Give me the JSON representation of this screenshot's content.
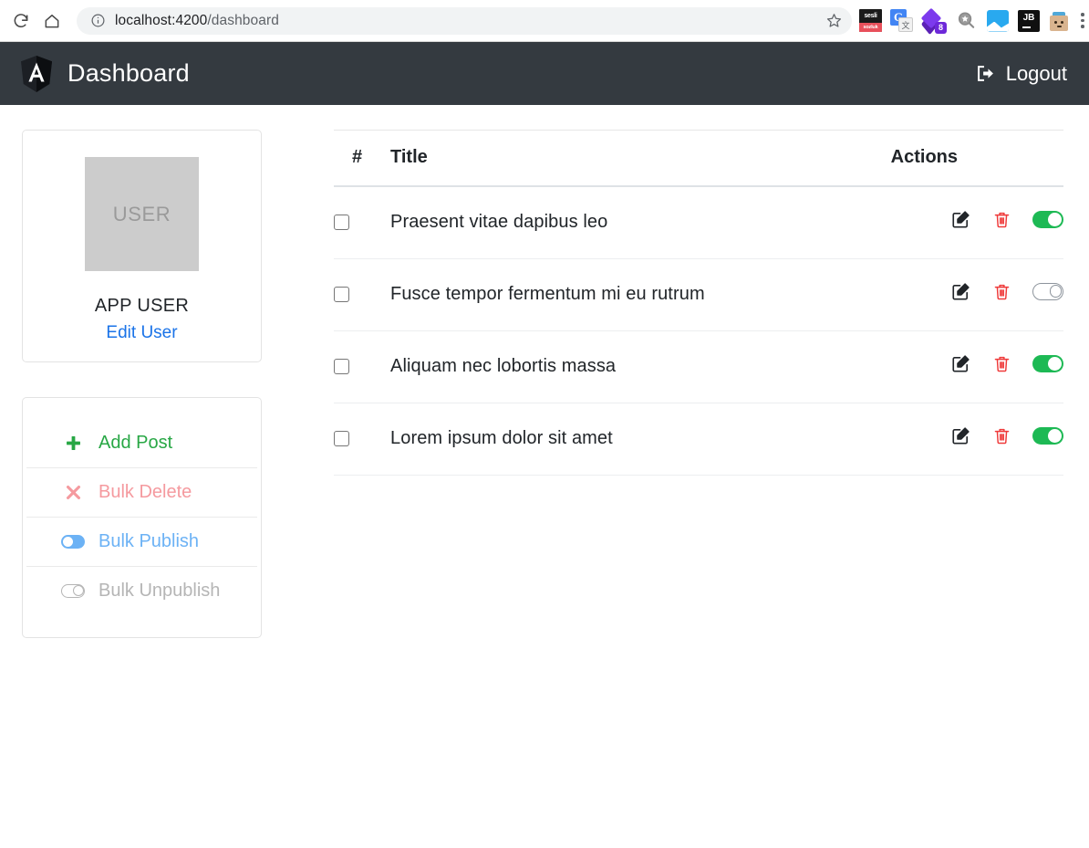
{
  "browser": {
    "reload_icon": "reload-icon",
    "home_icon": "home-icon",
    "info_icon": "info-icon",
    "url_host": "localhost:4200",
    "url_path": "/dashboard",
    "star_icon": "bookmark-star-icon",
    "extensions": [
      {
        "name": "sesli-sozluk-extension",
        "top_text": "sesli",
        "bottom_text": "sozluk"
      },
      {
        "name": "google-translate-extension",
        "letter": "G",
        "sub": "文"
      },
      {
        "name": "layers-extension",
        "badge": "8"
      },
      {
        "name": "search-star-extension"
      },
      {
        "name": "image-extension"
      },
      {
        "name": "jetbrains-extension",
        "label": "JB"
      },
      {
        "name": "robot-box-extension"
      }
    ],
    "menu_icon": "kebab-menu-icon"
  },
  "navbar": {
    "logo_icon": "angular-logo-icon",
    "title": "Dashboard",
    "logout_icon": "logout-icon",
    "logout_label": "Logout",
    "background": "#343a40"
  },
  "sidebar": {
    "user_card": {
      "thumbnail_text": "USER",
      "name": "APP USER",
      "edit_link": "Edit User",
      "link_color": "#1a73e8"
    },
    "actions_card": {
      "items": [
        {
          "label": "Add Post",
          "icon": "plus-icon",
          "state": "enabled",
          "color": "#28a745"
        },
        {
          "label": "Bulk Delete",
          "icon": "times-icon",
          "state": "disabled",
          "color": "#f59a9f"
        },
        {
          "label": "Bulk Publish",
          "icon": "toggle-on-icon",
          "state": "disabled",
          "color": "#6cb2f5"
        },
        {
          "label": "Bulk Unpublish",
          "icon": "toggle-off-icon",
          "state": "disabled",
          "color": "#b5b5b5"
        }
      ]
    }
  },
  "table": {
    "columns": {
      "num": "#",
      "title": "Title",
      "actions": "Actions"
    },
    "row_icons": {
      "edit": "edit-pencil-square-icon",
      "delete": "trash-icon",
      "publish_toggle": "toggle-switch-icon"
    },
    "rows": [
      {
        "checked": false,
        "title": "Praesent vitae dapibus leo",
        "published": true
      },
      {
        "checked": false,
        "title": "Fusce tempor fermentum mi eu rutrum",
        "published": false
      },
      {
        "checked": false,
        "title": "Aliquam nec lobortis massa",
        "published": true
      },
      {
        "checked": false,
        "title": "Lorem ipsum dolor sit amet",
        "published": true
      }
    ]
  }
}
